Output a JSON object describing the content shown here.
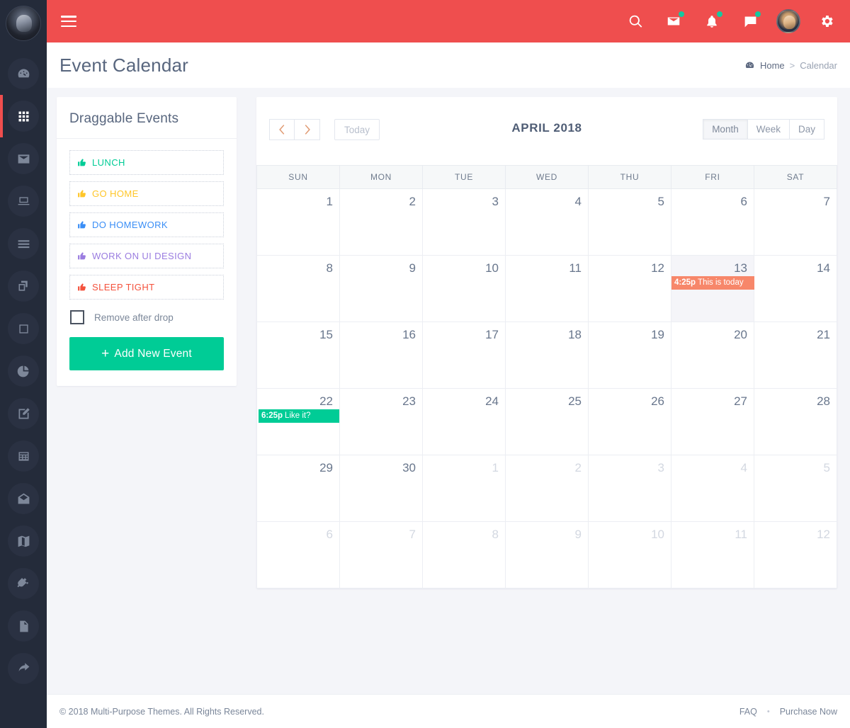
{
  "sidebar": {
    "avatar_name": "user-avatar",
    "items": [
      {
        "icon": "dashboard-icon",
        "name": "sidebar-item-dashboard",
        "active": false
      },
      {
        "icon": "grid-apps-icon",
        "name": "sidebar-item-apps",
        "active": true
      },
      {
        "icon": "envelope-icon",
        "name": "sidebar-item-mail",
        "active": false
      },
      {
        "icon": "laptop-icon",
        "name": "sidebar-item-ui",
        "active": false
      },
      {
        "icon": "list-icon",
        "name": "sidebar-item-list",
        "active": false
      },
      {
        "icon": "copy-icon",
        "name": "sidebar-item-pages",
        "active": false
      },
      {
        "icon": "square-icon",
        "name": "sidebar-item-components",
        "active": false
      },
      {
        "icon": "pie-chart-icon",
        "name": "sidebar-item-charts",
        "active": false
      },
      {
        "icon": "edit-square-icon",
        "name": "sidebar-item-forms",
        "active": false
      },
      {
        "icon": "table-icon",
        "name": "sidebar-item-tables",
        "active": false
      },
      {
        "icon": "open-envelope-icon",
        "name": "sidebar-item-inbox",
        "active": false
      },
      {
        "icon": "map-icon",
        "name": "sidebar-item-maps",
        "active": false
      },
      {
        "icon": "plug-icon",
        "name": "sidebar-item-plugins",
        "active": false
      },
      {
        "icon": "file-icon",
        "name": "sidebar-item-pages-extra",
        "active": false
      },
      {
        "icon": "share-arrow-icon",
        "name": "sidebar-item-more",
        "active": false
      }
    ]
  },
  "topbar": {
    "menu_toggle": "hamburger-icon",
    "icons": [
      {
        "name": "search-icon",
        "badge": false
      },
      {
        "name": "mail-icon",
        "badge": true
      },
      {
        "name": "bell-icon",
        "badge": true
      },
      {
        "name": "chat-icon",
        "badge": true
      }
    ],
    "gear": "gear-icon",
    "accent_color": "#ef4e4e",
    "badge_color": "#15c8a0"
  },
  "page": {
    "title": "Event Calendar",
    "breadcrumb": {
      "home": "Home",
      "separator": ">",
      "current": "Calendar"
    }
  },
  "draggable_panel": {
    "title": "Draggable Events",
    "events": [
      {
        "label": "LUNCH",
        "color": "#00cc96"
      },
      {
        "label": "GO HOME",
        "color": "#ffc628"
      },
      {
        "label": "DO HOMEWORK",
        "color": "#3a8ef6"
      },
      {
        "label": "WORK ON UI DESIGN",
        "color": "#9a7ce0"
      },
      {
        "label": "SLEEP TIGHT",
        "color": "#f4513c"
      }
    ],
    "checkbox_label": "Remove after drop",
    "checkbox_checked": false,
    "add_button": "Add New Event",
    "add_button_color": "#00cc96"
  },
  "calendar": {
    "prev_label": "‹",
    "next_label": "›",
    "today_label": "Today",
    "title": "APRIL 2018",
    "views": [
      {
        "label": "Month",
        "active": true
      },
      {
        "label": "Week",
        "active": false
      },
      {
        "label": "Day",
        "active": false
      }
    ],
    "weekdays": [
      "SUN",
      "MON",
      "TUE",
      "WED",
      "THU",
      "FRI",
      "SAT"
    ],
    "weeks": [
      [
        {
          "day": "1",
          "other": false
        },
        {
          "day": "2",
          "other": false
        },
        {
          "day": "3",
          "other": false
        },
        {
          "day": "4",
          "other": false
        },
        {
          "day": "5",
          "other": false
        },
        {
          "day": "6",
          "other": false
        },
        {
          "day": "7",
          "other": false
        }
      ],
      [
        {
          "day": "8",
          "other": false
        },
        {
          "day": "9",
          "other": false
        },
        {
          "day": "10",
          "other": false
        },
        {
          "day": "11",
          "other": false
        },
        {
          "day": "12",
          "other": false
        },
        {
          "day": "13",
          "other": false,
          "today": true,
          "event": {
            "time": "4:25p",
            "title": "This is today",
            "color": "#f7876a",
            "style": "ev-red"
          }
        },
        {
          "day": "14",
          "other": false
        }
      ],
      [
        {
          "day": "15",
          "other": false
        },
        {
          "day": "16",
          "other": false
        },
        {
          "day": "17",
          "other": false
        },
        {
          "day": "18",
          "other": false
        },
        {
          "day": "19",
          "other": false
        },
        {
          "day": "20",
          "other": false
        },
        {
          "day": "21",
          "other": false
        }
      ],
      [
        {
          "day": "22",
          "other": false,
          "event": {
            "time": "6:25p",
            "title": "Like it?",
            "color": "#00cc96",
            "style": "ev-green"
          }
        },
        {
          "day": "23",
          "other": false
        },
        {
          "day": "24",
          "other": false
        },
        {
          "day": "25",
          "other": false
        },
        {
          "day": "26",
          "other": false
        },
        {
          "day": "27",
          "other": false
        },
        {
          "day": "28",
          "other": false
        }
      ],
      [
        {
          "day": "29",
          "other": false
        },
        {
          "day": "30",
          "other": false
        },
        {
          "day": "1",
          "other": true
        },
        {
          "day": "2",
          "other": true
        },
        {
          "day": "3",
          "other": true
        },
        {
          "day": "4",
          "other": true
        },
        {
          "day": "5",
          "other": true
        }
      ],
      [
        {
          "day": "6",
          "other": true
        },
        {
          "day": "7",
          "other": true
        },
        {
          "day": "8",
          "other": true
        },
        {
          "day": "9",
          "other": true
        },
        {
          "day": "10",
          "other": true
        },
        {
          "day": "11",
          "other": true
        },
        {
          "day": "12",
          "other": true
        }
      ]
    ]
  },
  "footer": {
    "copyright": "© 2018 Multi-Purpose Themes. All Rights Reserved.",
    "links": [
      "FAQ",
      "Purchase Now"
    ],
    "separator": "•"
  }
}
